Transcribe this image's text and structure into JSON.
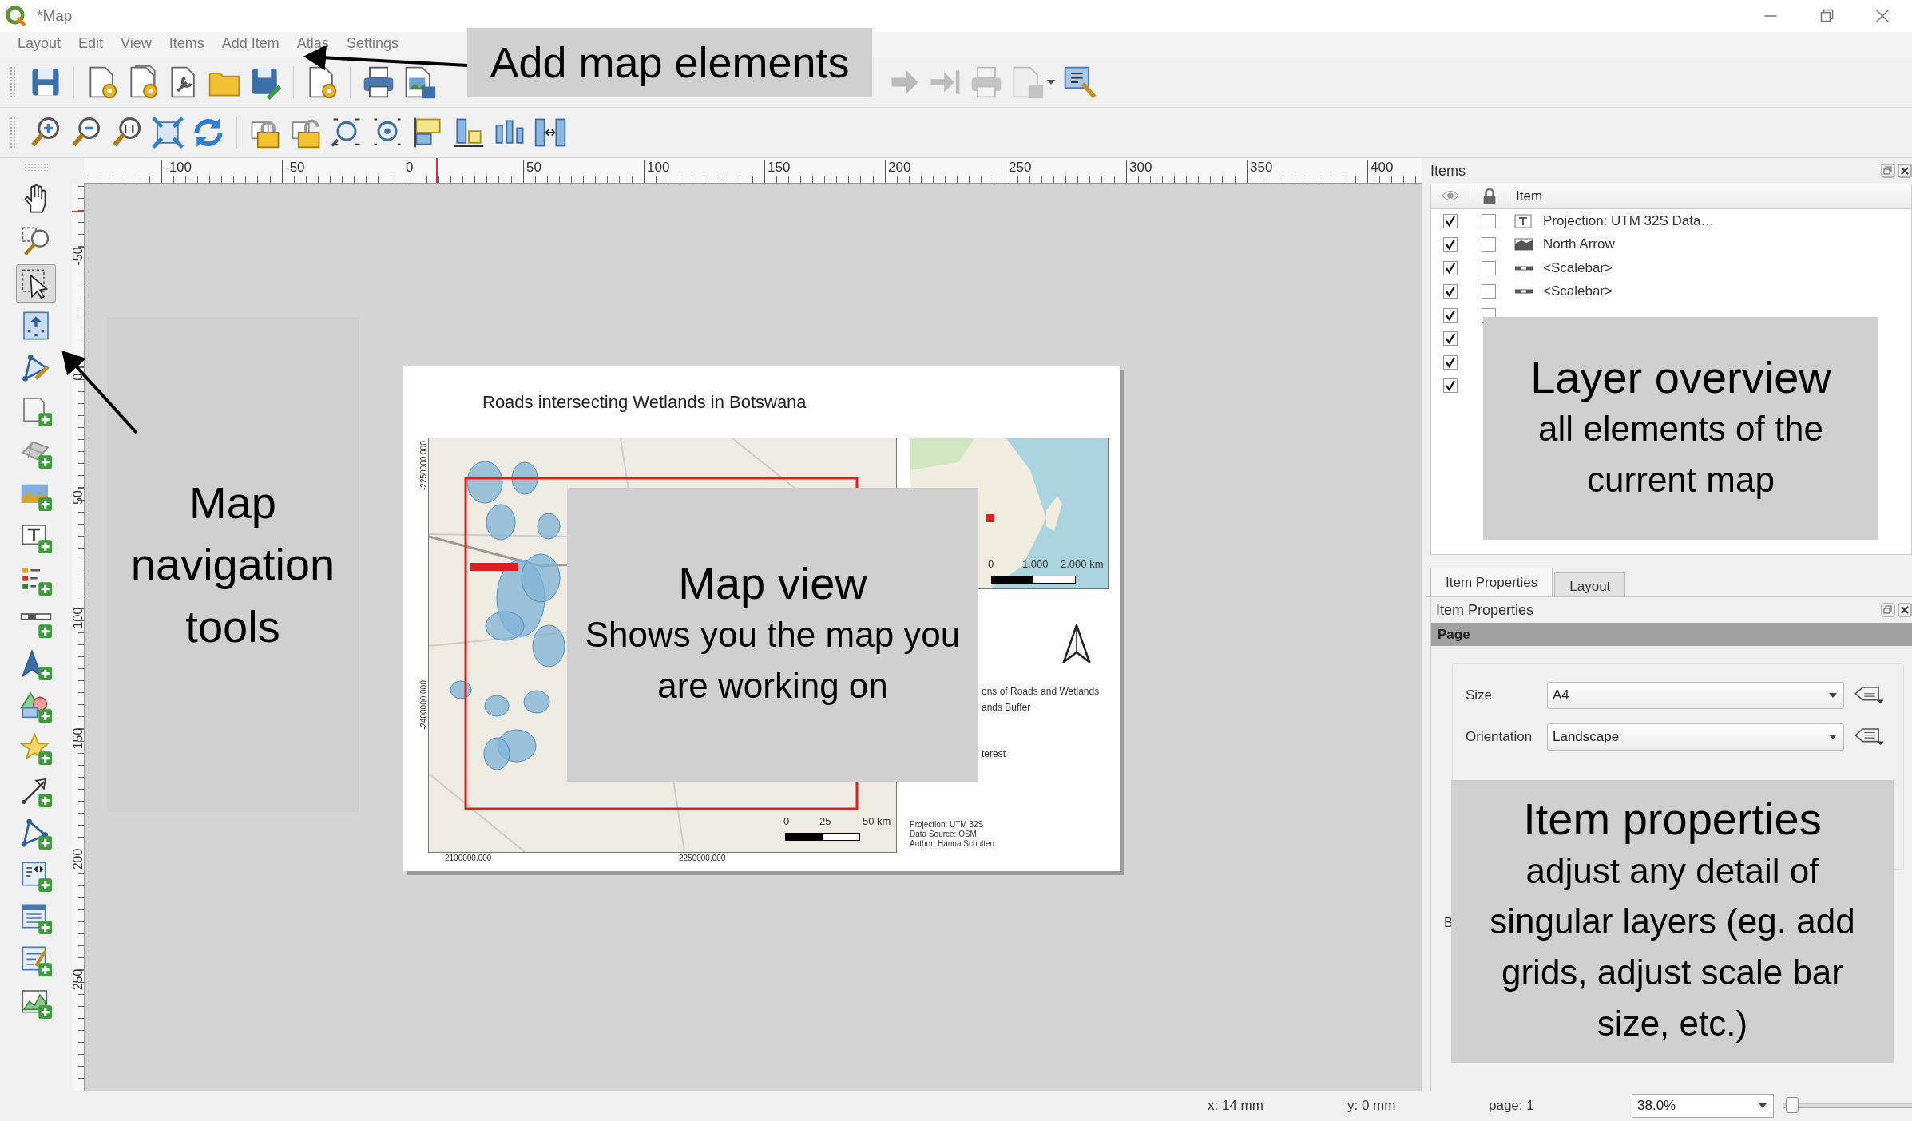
{
  "window": {
    "title": "*Map"
  },
  "menu": [
    "Layout",
    "Edit",
    "View",
    "Items",
    "Add Item",
    "Atlas",
    "Settings"
  ],
  "tools": [
    {
      "selected": false
    },
    {
      "selected": false
    },
    {
      "selected": true
    },
    {
      "selected": false
    },
    {
      "selected": false
    },
    {
      "selected": false
    },
    {
      "selected": false
    },
    {
      "selected": false
    },
    {
      "selected": false
    },
    {
      "selected": false
    },
    {
      "selected": false
    },
    {
      "selected": false
    },
    {
      "selected": false
    },
    {
      "selected": false
    },
    {
      "selected": false
    },
    {
      "selected": false
    },
    {
      "selected": false
    },
    {
      "selected": false
    },
    {
      "selected": false
    },
    {
      "selected": false
    }
  ],
  "ruler_horizontal": [
    "-100",
    "-50",
    "0",
    "50",
    "100",
    "150",
    "200",
    "250",
    "300",
    "350",
    "400"
  ],
  "ruler_vertical": [
    "-50",
    "0",
    "50",
    "100",
    "150",
    "200",
    "250"
  ],
  "layout_page": {
    "title": "Roads intersecting Wetlands in Botswana",
    "y_axis_labels": [
      "-2250000.000",
      "-2400000.000"
    ],
    "x_axis_labels": [
      "2100000.000",
      "2250000.000"
    ],
    "scale_labels": [
      "0",
      "25",
      "50 km"
    ],
    "inset_scale_labels": [
      "0",
      "1.000",
      "2.000 km"
    ],
    "legend_fragments": [
      "ons of Roads and Wetlands",
      "ands Buffer",
      "terest"
    ],
    "credits": [
      "Projection: UTM 32S",
      "Data Source: OSM",
      "Author: Hanna Schulten"
    ]
  },
  "items_panel": {
    "title": "Items",
    "column": "Item",
    "rows": [
      {
        "kind": "text",
        "label": "Projection: UTM 32S Data…",
        "visible": true,
        "locked": false
      },
      {
        "kind": "picture",
        "label": "North Arrow",
        "visible": true,
        "locked": false
      },
      {
        "kind": "scalebar",
        "label": "<Scalebar>",
        "visible": true,
        "locked": false
      },
      {
        "kind": "scalebar",
        "label": "<Scalebar>",
        "visible": true,
        "locked": false
      },
      {
        "kind": "covered",
        "visible": true,
        "locked": false
      },
      {
        "kind": "covered",
        "visible": true
      },
      {
        "kind": "covered",
        "visible": true
      },
      {
        "kind": "covered",
        "visible": true
      }
    ]
  },
  "properties_panel": {
    "tabs": [
      {
        "label": "Item Properties",
        "selected": true
      },
      {
        "label": "Layout",
        "selected": false
      }
    ],
    "title": "Item Properties",
    "section": "Page",
    "fields": [
      {
        "label": "Size",
        "value": "A4"
      },
      {
        "label": "Orientation",
        "value": "Landscape"
      }
    ],
    "partial_label": "B"
  },
  "status_bar": {
    "x": "x: 14 mm",
    "y": "y: 0 mm",
    "page": "page: 1",
    "zoom": "38.0%",
    "zoom_slider": {
      "level": 0.02
    }
  },
  "annotations": [
    {
      "title": "Add map elements"
    },
    {
      "title": "Map navigation tools"
    },
    {
      "title": "Map view",
      "text": "Shows you the map you are working on"
    },
    {
      "title": "Layer overview",
      "text": "all elements of the current map"
    },
    {
      "title": "Item properties",
      "text": "adjust any detail of singular layers (eg. add grids, adjust scale bar size, etc.)"
    }
  ]
}
